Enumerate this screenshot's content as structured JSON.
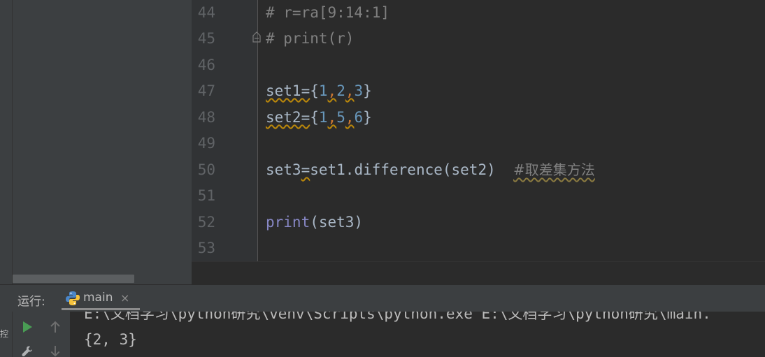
{
  "side_strip": {
    "vertical_label": "控"
  },
  "editor": {
    "lines": [
      {
        "no": "44",
        "text": "# r=ra[9:14:1]"
      },
      {
        "no": "45",
        "text": "# print(r)"
      },
      {
        "no": "46",
        "text": ""
      },
      {
        "no": "47",
        "set": "set1=",
        "nums": [
          "1",
          "2",
          "3"
        ]
      },
      {
        "no": "48",
        "set": "set2=",
        "nums": [
          "1",
          "5",
          "6"
        ]
      },
      {
        "no": "49",
        "text": ""
      },
      {
        "no": "50",
        "var": "set3",
        "op": "=",
        "call": "set1.difference(set2)",
        "comment": "#取差集方法"
      },
      {
        "no": "51",
        "text": ""
      },
      {
        "no": "52",
        "builtin": "print",
        "args": "(set3)"
      },
      {
        "no": "53",
        "text": ""
      }
    ]
  },
  "run": {
    "label": "运行:",
    "tab_name": "main",
    "tab_close": "×",
    "output": [
      "E:\\文档学习\\python研究\\venv\\Scripts\\python.exe E:\\文档学习\\python研究\\main.",
      "{2, 3}"
    ]
  },
  "icons": {
    "run": "play-icon",
    "up": "arrow-up-icon",
    "settings": "wrench-icon",
    "down": "arrow-down-icon",
    "python": "python-icon",
    "fold": "fold-marker-icon"
  },
  "colors": {
    "editor_bg": "#2b2b2b",
    "panel_bg": "#3c3f41",
    "gutter_bg": "#313335",
    "comment": "#808080",
    "number": "#6897bb",
    "builtin": "#8888c6",
    "play": "#499c54"
  }
}
